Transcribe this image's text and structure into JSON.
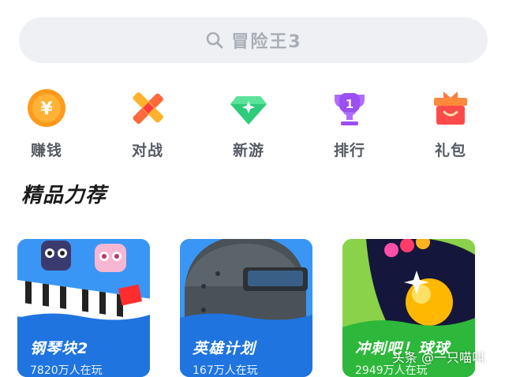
{
  "search": {
    "placeholder": "冒险王3",
    "icon": "search-icon"
  },
  "nav": [
    {
      "label": "赚钱",
      "icon": "coin-icon",
      "color": "#ff8a00"
    },
    {
      "label": "对战",
      "icon": "battle-icon",
      "color": "#ff5a3c"
    },
    {
      "label": "新游",
      "icon": "gem-icon",
      "color": "#2ecb7a"
    },
    {
      "label": "排行",
      "icon": "trophy-icon",
      "color": "#9b5cf6"
    },
    {
      "label": "礼包",
      "icon": "gift-icon",
      "color": "#ff4d4d"
    }
  ],
  "section": {
    "title": "精品力荐"
  },
  "games": [
    {
      "name": "钢琴块2",
      "players": "7820万人在玩",
      "bg": "#2f8cf0"
    },
    {
      "name": "英雄计划",
      "players": "167万人在玩",
      "bg": "#2f8cf0"
    },
    {
      "name": "冲刺吧！球球",
      "players": "2949万人在玩",
      "bg": "#3cc84a"
    }
  ],
  "watermark": {
    "text": "头条 @一只喵叫"
  }
}
